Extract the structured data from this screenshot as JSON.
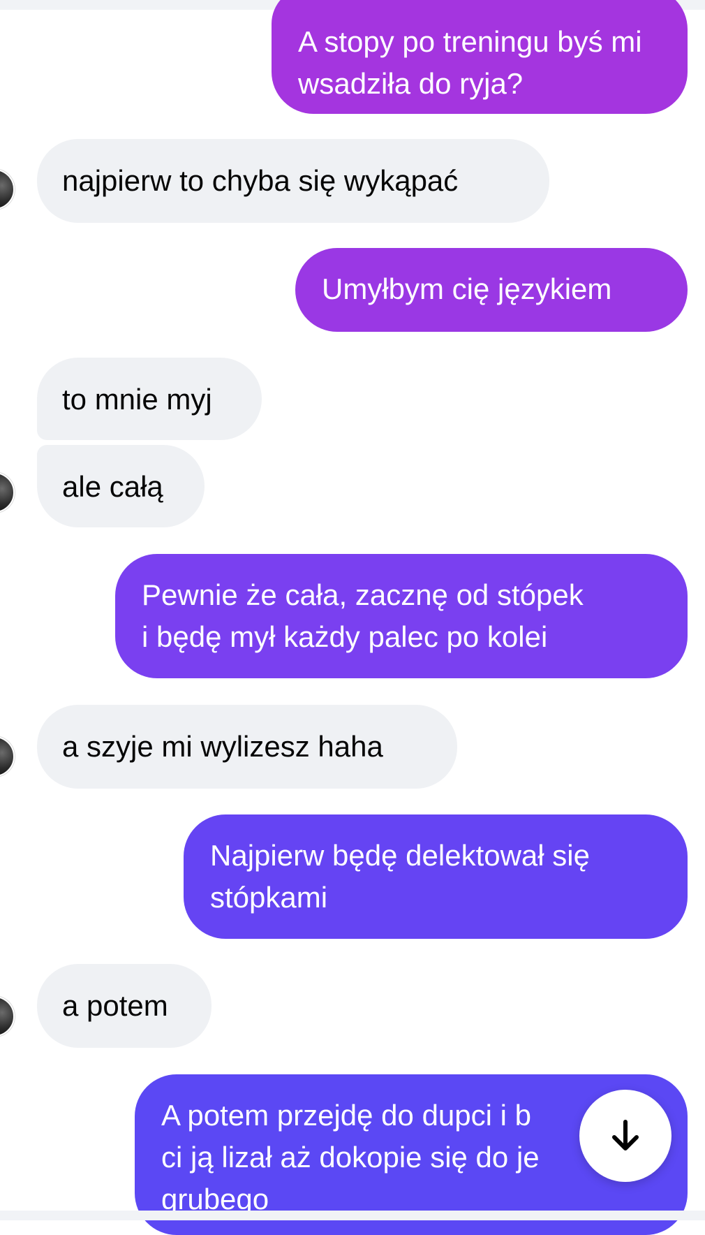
{
  "messages": [
    {
      "side": "out",
      "lines": [
        "A stopy po treningu byś mi",
        "wsadziła do ryja?"
      ],
      "color": "#a435df"
    },
    {
      "side": "in",
      "lines": [
        "najpierw to chyba się wykąpać"
      ]
    },
    {
      "side": "out",
      "lines": [
        "Umyłbym cię językiem"
      ],
      "color": "#9a38e4"
    },
    {
      "side": "in",
      "lines": [
        "to mnie myj"
      ]
    },
    {
      "side": "in",
      "lines": [
        "ale całą"
      ]
    },
    {
      "side": "out",
      "lines": [
        "Pewnie że cała, zacznę od stópek",
        "i będę mył każdy palec po kolei"
      ],
      "color": "#7a40f0"
    },
    {
      "side": "in",
      "lines": [
        "a szyje mi wylizesz haha"
      ]
    },
    {
      "side": "out",
      "lines": [
        "Najpierw będę delektował się",
        "stópkami"
      ],
      "color": "#6544f3"
    },
    {
      "side": "in",
      "lines": [
        "a potem"
      ]
    },
    {
      "side": "out",
      "lines": [
        "A potem przejdę do dupci i b",
        "ci ją lizał aż dokopie się do je",
        "grubego"
      ],
      "color": "#5b48f4"
    }
  ],
  "icons": {
    "avatar": "contact-avatar",
    "scroll": "arrow-down-icon"
  },
  "colors": {
    "incoming_bg": "#eff1f4",
    "incoming_text": "#050505",
    "outgoing_text": "#ffffff"
  }
}
